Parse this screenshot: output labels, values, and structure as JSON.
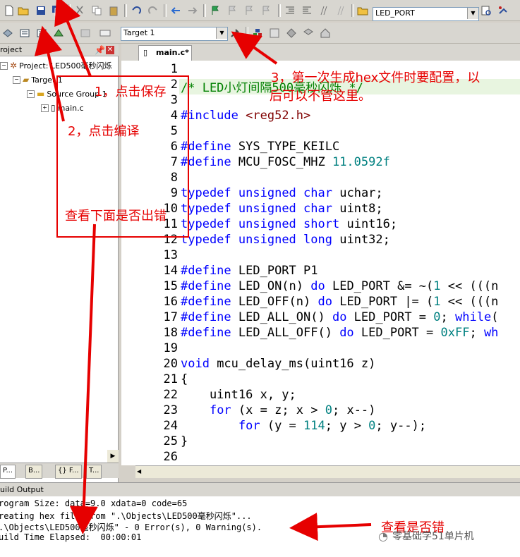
{
  "toolbar": {
    "port_combo": "LED_PORT",
    "target_combo": "Target 1"
  },
  "project_panel": {
    "title": "roject",
    "project_label": "Project: LED500毫秒闪烁",
    "target_label": "Target 1",
    "group_label": "Source Group 1",
    "file_label": "main.c",
    "tabs": [
      "P...",
      "B...",
      "{} F...",
      "T..."
    ]
  },
  "editor": {
    "tab_label": "main.c*",
    "lines": [
      {
        "n": "1",
        "html": ""
      },
      {
        "n": "2",
        "html": "<span class=\"cmt\">/* LED小灯间隔500毫秒闪烁 */</span>"
      },
      {
        "n": "3",
        "html": ""
      },
      {
        "n": "4",
        "html": "<span class=\"kw\">#include</span> <span class=\"str\">&lt;reg52.h&gt;</span>"
      },
      {
        "n": "5",
        "html": ""
      },
      {
        "n": "6",
        "html": "<span class=\"kw\">#define</span> SYS_TYPE_KEILC"
      },
      {
        "n": "7",
        "html": "<span class=\"kw\">#define</span> MCU_FOSC_MHZ <span class=\"num\">11.0592f</span>"
      },
      {
        "n": "8",
        "html": ""
      },
      {
        "n": "9",
        "html": "<span class=\"kw\">typedef</span> <span class=\"kw\">unsigned</span> <span class=\"kw\">char</span> uchar;"
      },
      {
        "n": "10",
        "html": "<span class=\"kw\">typedef</span> <span class=\"kw\">unsigned</span> <span class=\"kw\">char</span> uint8;"
      },
      {
        "n": "11",
        "html": "<span class=\"kw\">typedef</span> <span class=\"kw\">unsigned</span> <span class=\"kw\">short</span> uint16;"
      },
      {
        "n": "12",
        "html": "<span class=\"kw\">typedef</span> <span class=\"kw\">unsigned</span> <span class=\"kw\">long</span> uint32;"
      },
      {
        "n": "13",
        "html": ""
      },
      {
        "n": "14",
        "html": "<span class=\"kw\">#define</span> LED_PORT P1"
      },
      {
        "n": "15",
        "html": "<span class=\"kw\">#define</span> LED_ON(n) <span class=\"kw\">do</span> LED_PORT &amp;= ~(<span class=\"num\">1</span> &lt;&lt; (((n"
      },
      {
        "n": "16",
        "html": "<span class=\"kw\">#define</span> LED_OFF(n) <span class=\"kw\">do</span> LED_PORT |= (<span class=\"num\">1</span> &lt;&lt; (((n"
      },
      {
        "n": "17",
        "html": "<span class=\"kw\">#define</span> LED_ALL_ON() <span class=\"kw\">do</span> LED_PORT = <span class=\"num\">0</span>; <span class=\"kw\">while</span>("
      },
      {
        "n": "18",
        "html": "<span class=\"kw\">#define</span> LED_ALL_OFF() <span class=\"kw\">do</span> LED_PORT = <span class=\"num\">0xFF</span>; <span class=\"kw\">wh</span>"
      },
      {
        "n": "19",
        "html": ""
      },
      {
        "n": "20",
        "html": "<span class=\"kw\">void</span> mcu_delay_ms(uint16 z)"
      },
      {
        "n": "21",
        "html": "{"
      },
      {
        "n": "22",
        "html": "    uint16 x, y;"
      },
      {
        "n": "23",
        "html": "    <span class=\"kw\">for</span> (x = z; x &gt; <span class=\"num\">0</span>; x--)"
      },
      {
        "n": "24",
        "html": "        <span class=\"kw\">for</span> (y = <span class=\"num\">114</span>; y &gt; <span class=\"num\">0</span>; y--);"
      },
      {
        "n": "25",
        "html": "}"
      },
      {
        "n": "26",
        "html": ""
      }
    ]
  },
  "output": {
    "title": "uild Output",
    "lines": [
      "rogram Size: data=9.0 xdata=0 code=65",
      "reating hex file from \".\\Objects\\LED500毫秒闪烁\"...",
      ".\\Objects\\LED500毫秒闪烁\" - 0 Error(s), 0 Warning(s).",
      "uild Time Elapsed:  00:00:01"
    ]
  },
  "annotations": {
    "save": "1，点击保存",
    "compile": "2，点击编译",
    "config_line1": "3，第一次生成hex文件时要配置，以",
    "config_line2": "后可以不管这里。",
    "check_below": "查看下面是否出错",
    "check_errors": "查看是否错"
  },
  "watermark": "零基础学51单片机",
  "colors": {
    "annotation": "#e60000",
    "keyword": "#0000ff",
    "number": "#008080",
    "string": "#800000",
    "comment": "#008000"
  }
}
